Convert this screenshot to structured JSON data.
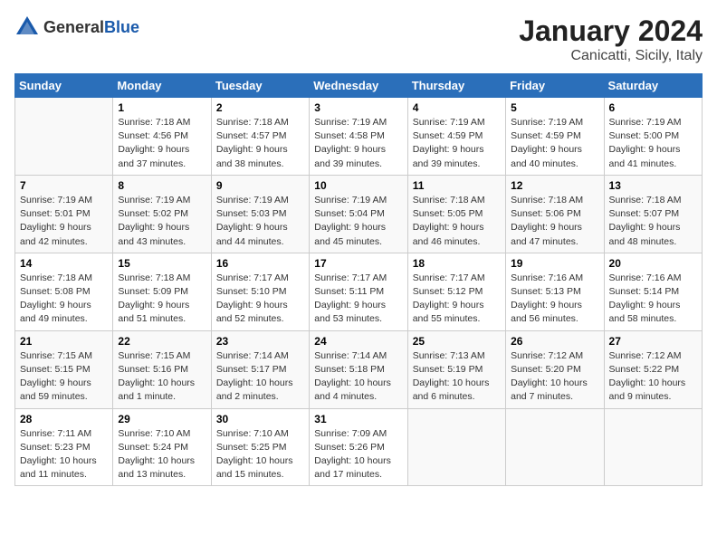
{
  "header": {
    "logo_general": "General",
    "logo_blue": "Blue",
    "title": "January 2024",
    "subtitle": "Canicatti, Sicily, Italy"
  },
  "days_of_week": [
    "Sunday",
    "Monday",
    "Tuesday",
    "Wednesday",
    "Thursday",
    "Friday",
    "Saturday"
  ],
  "weeks": [
    [
      {
        "num": "",
        "sunrise": "",
        "sunset": "",
        "daylight": ""
      },
      {
        "num": "1",
        "sunrise": "Sunrise: 7:18 AM",
        "sunset": "Sunset: 4:56 PM",
        "daylight": "Daylight: 9 hours and 37 minutes."
      },
      {
        "num": "2",
        "sunrise": "Sunrise: 7:18 AM",
        "sunset": "Sunset: 4:57 PM",
        "daylight": "Daylight: 9 hours and 38 minutes."
      },
      {
        "num": "3",
        "sunrise": "Sunrise: 7:19 AM",
        "sunset": "Sunset: 4:58 PM",
        "daylight": "Daylight: 9 hours and 39 minutes."
      },
      {
        "num": "4",
        "sunrise": "Sunrise: 7:19 AM",
        "sunset": "Sunset: 4:59 PM",
        "daylight": "Daylight: 9 hours and 39 minutes."
      },
      {
        "num": "5",
        "sunrise": "Sunrise: 7:19 AM",
        "sunset": "Sunset: 4:59 PM",
        "daylight": "Daylight: 9 hours and 40 minutes."
      },
      {
        "num": "6",
        "sunrise": "Sunrise: 7:19 AM",
        "sunset": "Sunset: 5:00 PM",
        "daylight": "Daylight: 9 hours and 41 minutes."
      }
    ],
    [
      {
        "num": "7",
        "sunrise": "Sunrise: 7:19 AM",
        "sunset": "Sunset: 5:01 PM",
        "daylight": "Daylight: 9 hours and 42 minutes."
      },
      {
        "num": "8",
        "sunrise": "Sunrise: 7:19 AM",
        "sunset": "Sunset: 5:02 PM",
        "daylight": "Daylight: 9 hours and 43 minutes."
      },
      {
        "num": "9",
        "sunrise": "Sunrise: 7:19 AM",
        "sunset": "Sunset: 5:03 PM",
        "daylight": "Daylight: 9 hours and 44 minutes."
      },
      {
        "num": "10",
        "sunrise": "Sunrise: 7:19 AM",
        "sunset": "Sunset: 5:04 PM",
        "daylight": "Daylight: 9 hours and 45 minutes."
      },
      {
        "num": "11",
        "sunrise": "Sunrise: 7:18 AM",
        "sunset": "Sunset: 5:05 PM",
        "daylight": "Daylight: 9 hours and 46 minutes."
      },
      {
        "num": "12",
        "sunrise": "Sunrise: 7:18 AM",
        "sunset": "Sunset: 5:06 PM",
        "daylight": "Daylight: 9 hours and 47 minutes."
      },
      {
        "num": "13",
        "sunrise": "Sunrise: 7:18 AM",
        "sunset": "Sunset: 5:07 PM",
        "daylight": "Daylight: 9 hours and 48 minutes."
      }
    ],
    [
      {
        "num": "14",
        "sunrise": "Sunrise: 7:18 AM",
        "sunset": "Sunset: 5:08 PM",
        "daylight": "Daylight: 9 hours and 49 minutes."
      },
      {
        "num": "15",
        "sunrise": "Sunrise: 7:18 AM",
        "sunset": "Sunset: 5:09 PM",
        "daylight": "Daylight: 9 hours and 51 minutes."
      },
      {
        "num": "16",
        "sunrise": "Sunrise: 7:17 AM",
        "sunset": "Sunset: 5:10 PM",
        "daylight": "Daylight: 9 hours and 52 minutes."
      },
      {
        "num": "17",
        "sunrise": "Sunrise: 7:17 AM",
        "sunset": "Sunset: 5:11 PM",
        "daylight": "Daylight: 9 hours and 53 minutes."
      },
      {
        "num": "18",
        "sunrise": "Sunrise: 7:17 AM",
        "sunset": "Sunset: 5:12 PM",
        "daylight": "Daylight: 9 hours and 55 minutes."
      },
      {
        "num": "19",
        "sunrise": "Sunrise: 7:16 AM",
        "sunset": "Sunset: 5:13 PM",
        "daylight": "Daylight: 9 hours and 56 minutes."
      },
      {
        "num": "20",
        "sunrise": "Sunrise: 7:16 AM",
        "sunset": "Sunset: 5:14 PM",
        "daylight": "Daylight: 9 hours and 58 minutes."
      }
    ],
    [
      {
        "num": "21",
        "sunrise": "Sunrise: 7:15 AM",
        "sunset": "Sunset: 5:15 PM",
        "daylight": "Daylight: 9 hours and 59 minutes."
      },
      {
        "num": "22",
        "sunrise": "Sunrise: 7:15 AM",
        "sunset": "Sunset: 5:16 PM",
        "daylight": "Daylight: 10 hours and 1 minute."
      },
      {
        "num": "23",
        "sunrise": "Sunrise: 7:14 AM",
        "sunset": "Sunset: 5:17 PM",
        "daylight": "Daylight: 10 hours and 2 minutes."
      },
      {
        "num": "24",
        "sunrise": "Sunrise: 7:14 AM",
        "sunset": "Sunset: 5:18 PM",
        "daylight": "Daylight: 10 hours and 4 minutes."
      },
      {
        "num": "25",
        "sunrise": "Sunrise: 7:13 AM",
        "sunset": "Sunset: 5:19 PM",
        "daylight": "Daylight: 10 hours and 6 minutes."
      },
      {
        "num": "26",
        "sunrise": "Sunrise: 7:12 AM",
        "sunset": "Sunset: 5:20 PM",
        "daylight": "Daylight: 10 hours and 7 minutes."
      },
      {
        "num": "27",
        "sunrise": "Sunrise: 7:12 AM",
        "sunset": "Sunset: 5:22 PM",
        "daylight": "Daylight: 10 hours and 9 minutes."
      }
    ],
    [
      {
        "num": "28",
        "sunrise": "Sunrise: 7:11 AM",
        "sunset": "Sunset: 5:23 PM",
        "daylight": "Daylight: 10 hours and 11 minutes."
      },
      {
        "num": "29",
        "sunrise": "Sunrise: 7:10 AM",
        "sunset": "Sunset: 5:24 PM",
        "daylight": "Daylight: 10 hours and 13 minutes."
      },
      {
        "num": "30",
        "sunrise": "Sunrise: 7:10 AM",
        "sunset": "Sunset: 5:25 PM",
        "daylight": "Daylight: 10 hours and 15 minutes."
      },
      {
        "num": "31",
        "sunrise": "Sunrise: 7:09 AM",
        "sunset": "Sunset: 5:26 PM",
        "daylight": "Daylight: 10 hours and 17 minutes."
      },
      {
        "num": "",
        "sunrise": "",
        "sunset": "",
        "daylight": ""
      },
      {
        "num": "",
        "sunrise": "",
        "sunset": "",
        "daylight": ""
      },
      {
        "num": "",
        "sunrise": "",
        "sunset": "",
        "daylight": ""
      }
    ]
  ]
}
